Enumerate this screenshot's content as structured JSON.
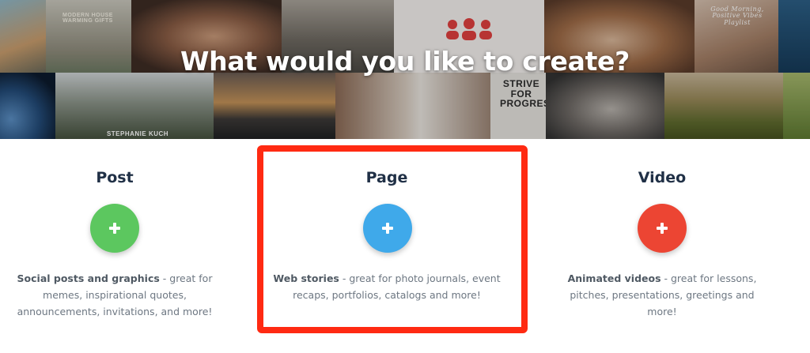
{
  "hero": {
    "title": "What would you like to create?",
    "captions": {
      "house": "MODERN HOUSE WARMING GIFTS",
      "stephanie": "STEPHANIE KUCH",
      "strive": "STRIVE FOR PROGRESS",
      "morning": "Good Morning, Positive Vibes Playlist"
    }
  },
  "options": [
    {
      "title": "Post",
      "color": "#5cc75f",
      "icon": "plus-icon",
      "desc_bold": "Social posts and graphics",
      "desc_rest": " - great for memes, inspirational quotes, announcements, invitations, and more!"
    },
    {
      "title": "Page",
      "color": "#3fa9ea",
      "icon": "plus-icon",
      "desc_bold": "Web stories",
      "desc_rest": " - great for photo journals, event recaps, portfolios, catalogs and more!"
    },
    {
      "title": "Video",
      "color": "#ec4533",
      "icon": "plus-icon",
      "desc_bold": "Animated videos",
      "desc_rest": " - great for lessons, pitches, presentations, greetings and more!"
    }
  ],
  "highlight_color": "#ff2a12"
}
